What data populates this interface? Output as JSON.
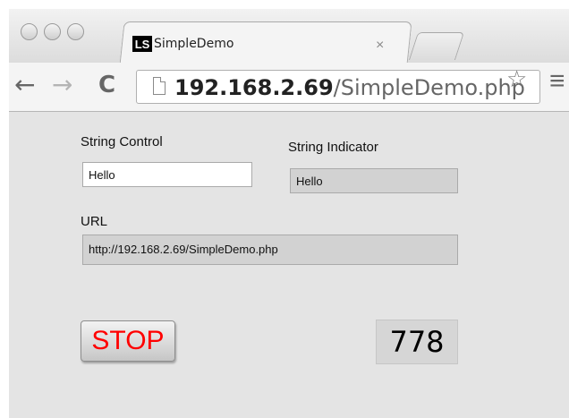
{
  "tab": {
    "icon_text": "LS",
    "title": "SimpleDemo",
    "close": "×"
  },
  "nav": {
    "back": "←",
    "forward": "→",
    "reload": "C"
  },
  "address": {
    "host": "192.168.2.69",
    "path": "/SimpleDemo.php"
  },
  "form": {
    "string_control_label": "String Control",
    "string_control_value": "Hello",
    "string_indicator_label": "String Indicator",
    "string_indicator_value": "Hello",
    "url_label": "URL",
    "url_value": "http://192.168.2.69/SimpleDemo.php",
    "stop_label": "STOP",
    "numeric_value": "778"
  },
  "colors": {
    "stop_text": "#ff0000",
    "panel_bg": "#e4e4e4",
    "indicator_bg": "#d2d2d2"
  },
  "icons": [
    "window-close-icon",
    "window-minimize-icon",
    "window-zoom-icon",
    "back-arrow-icon",
    "forward-arrow-icon",
    "reload-icon",
    "page-icon",
    "bookmark-star-icon",
    "menu-icon"
  ]
}
